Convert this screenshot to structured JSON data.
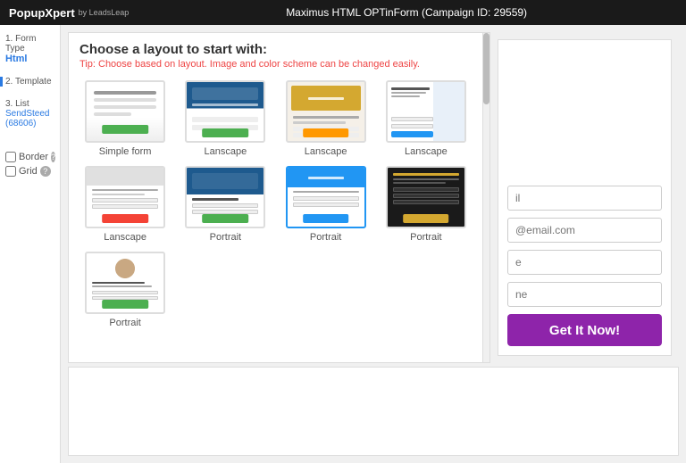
{
  "topbar": {
    "brand": "PopupXpert",
    "brand_sub": "by LeadsLeap",
    "campaign": "Maximus HTML OPTinForm (Campaign ID: 29559)"
  },
  "sidebar": {
    "steps": [
      {
        "num": "1.",
        "label": "Form Type",
        "sub": "Html"
      },
      {
        "num": "2.",
        "label": "Template",
        "sub": ""
      },
      {
        "num": "3.",
        "label": "List",
        "sub": "SendSteed\n(68606)"
      }
    ],
    "checkboxes": [
      {
        "label": "Border",
        "has_info": true
      },
      {
        "label": "Grid",
        "has_info": true
      }
    ]
  },
  "layout_panel": {
    "title": "Choose a layout to start with:",
    "tip_prefix": "Tip: ",
    "tip_highlight": "Choose based on layout.",
    "tip_suffix": " Image and color scheme can be changed easily.",
    "templates": [
      {
        "label": "Simple form",
        "style": "simple"
      },
      {
        "label": "Lanscape",
        "style": "landscape1"
      },
      {
        "label": "Lanscape",
        "style": "landscape2"
      },
      {
        "label": "Lanscape",
        "style": "landscape3"
      },
      {
        "label": "Lanscape",
        "style": "portrait1"
      },
      {
        "label": "Portrait",
        "style": "portrait2"
      },
      {
        "label": "Portrait",
        "style": "portrait3"
      },
      {
        "label": "Portrait",
        "style": "portrait4"
      },
      {
        "label": "Portrait",
        "style": "portrait5"
      }
    ]
  },
  "preview": {
    "fields": [
      {
        "placeholder": "il",
        "value": ""
      },
      {
        "placeholder": "@email.com",
        "value": ""
      },
      {
        "placeholder": "e",
        "value": ""
      },
      {
        "placeholder": "ne",
        "value": ""
      }
    ],
    "button_label": "Get It Now!"
  }
}
